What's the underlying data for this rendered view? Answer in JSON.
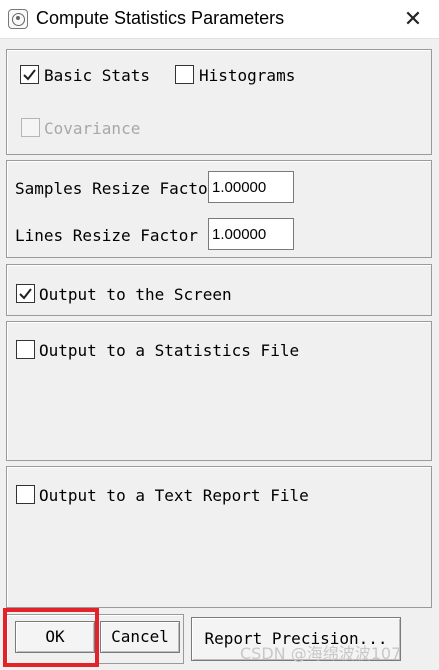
{
  "window": {
    "title": "Compute Statistics Parameters",
    "app_icon": "statistics-app-icon",
    "close_glyph": "✕"
  },
  "stats_options": {
    "basic_stats": {
      "label": "Basic Stats",
      "checked": true
    },
    "histograms": {
      "label": "Histograms",
      "checked": false
    },
    "covariance": {
      "label": "Covariance",
      "checked": false,
      "enabled": false
    }
  },
  "resize": {
    "samples_label": "Samples Resize Factor",
    "samples_value": "1.00000",
    "lines_label": "Lines Resize Factor",
    "lines_value": "1.00000"
  },
  "output": {
    "screen": {
      "label": "Output to the Screen",
      "checked": true
    },
    "statistics_file": {
      "label": "Output to a Statistics File",
      "checked": false
    },
    "text_report_file": {
      "label": "Output to a Text Report File",
      "checked": false
    }
  },
  "buttons": {
    "ok": "OK",
    "cancel": "Cancel",
    "report_precision": "Report Precision..."
  },
  "watermark": "CSDN @海绵波波107",
  "colors": {
    "highlight": "#e3232a",
    "background": "#f0f0f0"
  }
}
